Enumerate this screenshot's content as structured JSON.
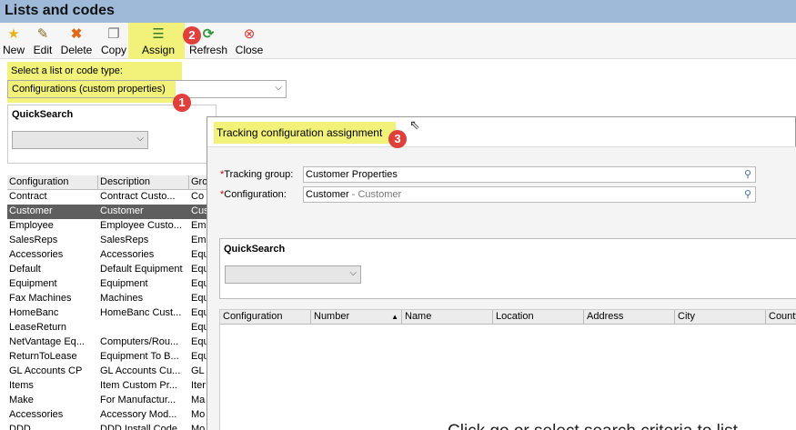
{
  "window": {
    "title": "Lists and codes"
  },
  "toolbar": {
    "new": "New",
    "edit": "Edit",
    "delete": "Delete",
    "copy": "Copy",
    "assign": "Assign",
    "refresh": "Refresh",
    "close": "Close"
  },
  "selector": {
    "label": "Select a list or code type:",
    "value": "Configurations (custom properties)"
  },
  "quicksearch": {
    "title": "QuickSearch"
  },
  "list": {
    "columns": [
      "Configuration",
      "Description",
      "Gro"
    ],
    "rows": [
      [
        "Contract",
        "Contract Custo...",
        "Co"
      ],
      [
        "Customer",
        "Customer",
        "Cus"
      ],
      [
        "Employee",
        "Employee Custo...",
        "Em"
      ],
      [
        "SalesReps",
        "SalesReps",
        "Em"
      ],
      [
        "Accessories",
        "Accessories",
        "Equ"
      ],
      [
        "Default",
        "Default Equipment",
        "Equ"
      ],
      [
        "Equipment",
        "Equipment",
        "Equ"
      ],
      [
        "Fax Machines",
        "Machines",
        "Equ"
      ],
      [
        "HomeBanc",
        "HomeBanc Cust...",
        "Equ"
      ],
      [
        "LeaseReturn",
        "",
        "Equ"
      ],
      [
        "NetVantage Eq...",
        "Computers/Rou...",
        "Equ"
      ],
      [
        "ReturnToLease",
        "Equipment To B...",
        "Equ"
      ],
      [
        "GL Accounts CP",
        "GL Accounts Cu...",
        "GL"
      ],
      [
        "Items",
        "Item Custom Pr...",
        "Iter"
      ],
      [
        "Make",
        "For Manufactur...",
        "Ma"
      ],
      [
        "Accessories",
        "Accessory Mod...",
        "Mo"
      ],
      [
        "DDD",
        "DDD Install Code",
        "Mo"
      ]
    ],
    "selected_index": 1
  },
  "dialog": {
    "title": "Tracking configuration assignment",
    "tracking_group_label": "Tracking group:",
    "tracking_group_value": "Customer Properties",
    "configuration_label": "Configuration:",
    "configuration_value": "Customer",
    "configuration_sub": " - Customer",
    "quicksearch_title": "QuickSearch",
    "columns": [
      "Configuration",
      "Number",
      "Name",
      "Location",
      "Address",
      "City",
      "County"
    ],
    "empty_message": "Click go or select search criteria to list..."
  },
  "annotations": [
    "1",
    "2",
    "3"
  ],
  "colors": {
    "highlight": "#f2f27a",
    "badge": "#e0403c",
    "titlebar": "#9fb9d9",
    "selected_row": "#5e5e5e"
  }
}
